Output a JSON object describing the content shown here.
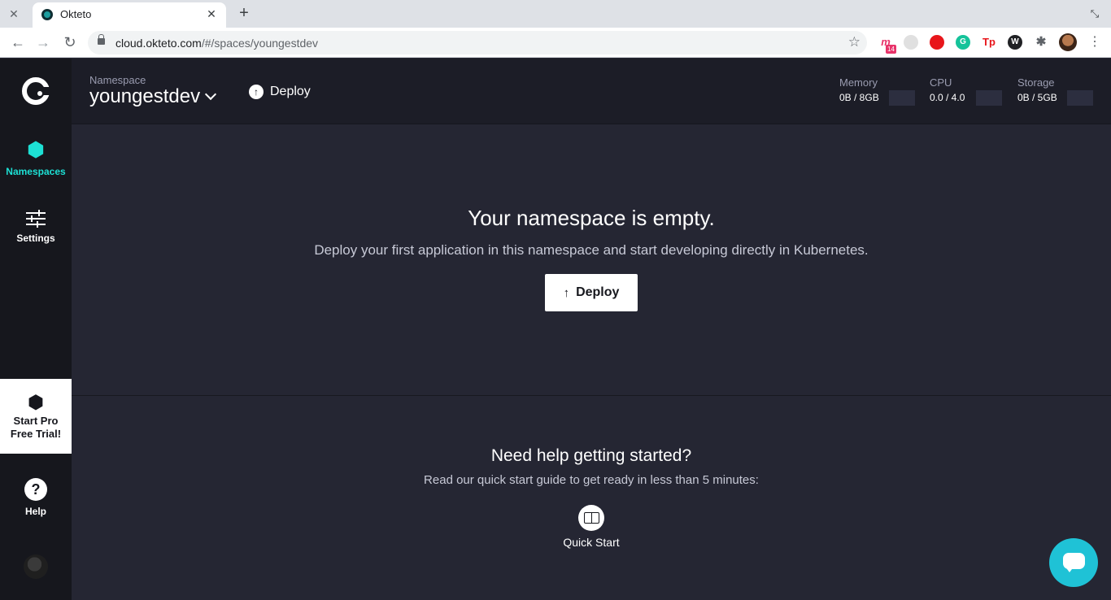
{
  "browser": {
    "tab_title": "Okteto",
    "url_host": "cloud.okteto.com",
    "url_path": "/#/spaces/youngestdev",
    "ext_badge": "14",
    "ext_tp_label": "Tp"
  },
  "sidebar": {
    "items": [
      {
        "label": "Namespaces",
        "icon": "hexagon-icon"
      },
      {
        "label": "Settings",
        "icon": "sliders-icon"
      }
    ],
    "promo_line1": "Start Pro",
    "promo_line2": "Free Trial!",
    "help_label": "Help",
    "help_glyph": "?"
  },
  "header": {
    "namespace_label": "Namespace",
    "namespace_name": "youngestdev",
    "deploy_label": "Deploy",
    "metrics": [
      {
        "label": "Memory",
        "value": "0B / 8GB"
      },
      {
        "label": "CPU",
        "value": "0.0 / 4.0"
      },
      {
        "label": "Storage",
        "value": "0B / 5GB"
      }
    ]
  },
  "main": {
    "empty_title": "Your namespace is empty.",
    "empty_subtitle": "Deploy your first application in this namespace and start developing directly in Kubernetes.",
    "deploy_button": "Deploy",
    "help_title": "Need help getting started?",
    "help_subtitle": "Read our quick start guide to get ready in less than 5 minutes:",
    "quick_start_label": "Quick Start"
  },
  "colors": {
    "accent": "#1de0d4",
    "sidebar_bg": "#16171d",
    "main_bg": "#252633",
    "chat_button": "#1fc2d6"
  }
}
